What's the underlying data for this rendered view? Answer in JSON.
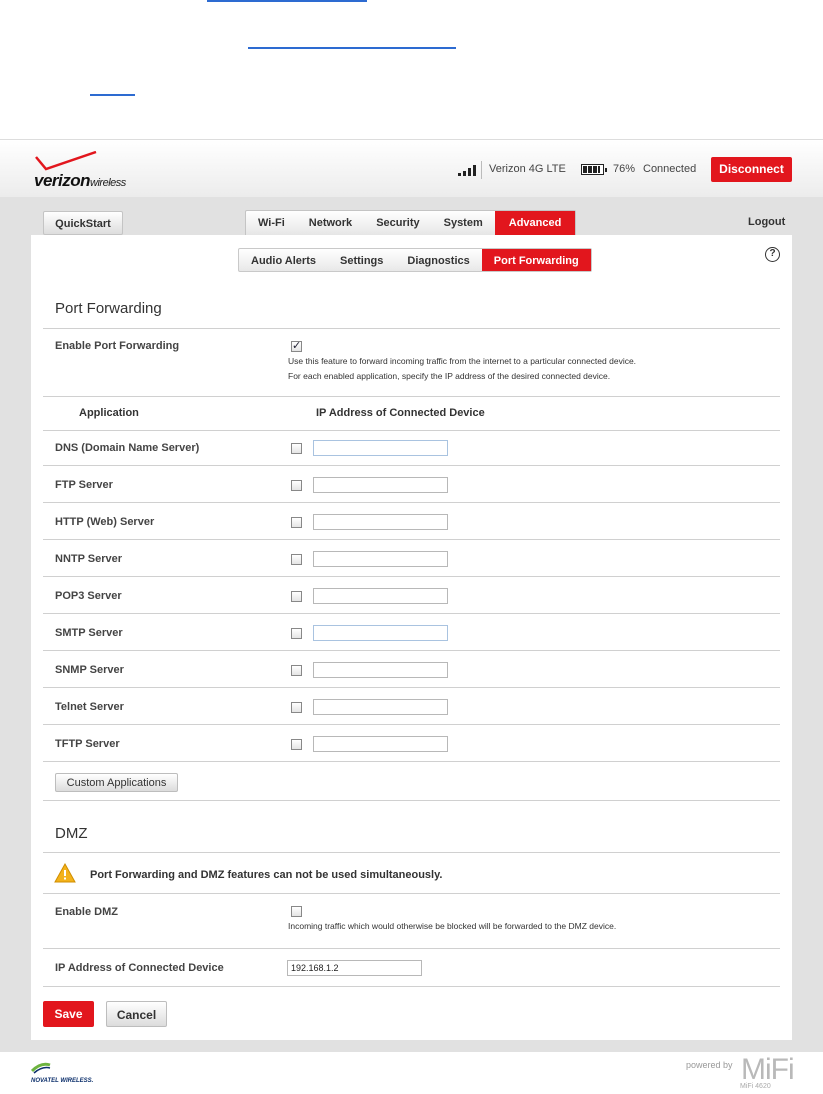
{
  "header": {
    "brand_main": "verizon",
    "brand_sub": "wireless",
    "carrier": "Verizon 4G LTE",
    "battery": "76%",
    "status": "Connected",
    "disconnect_label": "Disconnect",
    "accent_color": "#e2161d"
  },
  "nav": {
    "quickstart_label": "QuickStart",
    "tabs": [
      {
        "label": "Wi-Fi"
      },
      {
        "label": "Network"
      },
      {
        "label": "Security"
      },
      {
        "label": "System"
      },
      {
        "label": "Advanced",
        "active": true
      }
    ],
    "logout_label": "Logout"
  },
  "subtabs": [
    {
      "label": "Audio Alerts"
    },
    {
      "label": "Settings"
    },
    {
      "label": "Diagnostics"
    },
    {
      "label": "Port Forwarding",
      "active": true
    }
  ],
  "help_label": "?",
  "port_forwarding": {
    "title": "Port Forwarding",
    "enable_label": "Enable Port Forwarding",
    "enable_checked": true,
    "help_line1": "Use this feature to forward incoming traffic from the internet to a particular connected device.",
    "help_line2": "For each enabled application, specify the IP address of the desired connected device.",
    "col_application": "Application",
    "col_ip": "IP Address of Connected Device",
    "applications": [
      {
        "name": "DNS (Domain Name Server)",
        "checked": false,
        "ip": ""
      },
      {
        "name": "FTP Server",
        "checked": false,
        "ip": ""
      },
      {
        "name": "HTTP (Web) Server",
        "checked": false,
        "ip": ""
      },
      {
        "name": "NNTP Server",
        "checked": false,
        "ip": ""
      },
      {
        "name": "POP3 Server",
        "checked": false,
        "ip": ""
      },
      {
        "name": "SMTP Server",
        "checked": false,
        "ip": ""
      },
      {
        "name": "SNMP Server",
        "checked": false,
        "ip": ""
      },
      {
        "name": "Telnet Server",
        "checked": false,
        "ip": ""
      },
      {
        "name": "TFTP Server",
        "checked": false,
        "ip": ""
      }
    ],
    "custom_apps_label": "Custom Applications"
  },
  "dmz": {
    "title": "DMZ",
    "warning": "Port Forwarding and DMZ features can not be used simultaneously.",
    "enable_label": "Enable DMZ",
    "enable_checked": false,
    "help": "Incoming traffic which would otherwise be blocked will be forwarded to the DMZ device.",
    "ip_label": "IP Address of Connected Device",
    "ip_value": "192.168.1.2"
  },
  "actions": {
    "save_label": "Save",
    "cancel_label": "Cancel"
  },
  "footer": {
    "partner_text": "NOVATEL WIRELESS.",
    "powered_by": "powered by",
    "mifi": "MiFi",
    "model": "MiFi 4620"
  }
}
